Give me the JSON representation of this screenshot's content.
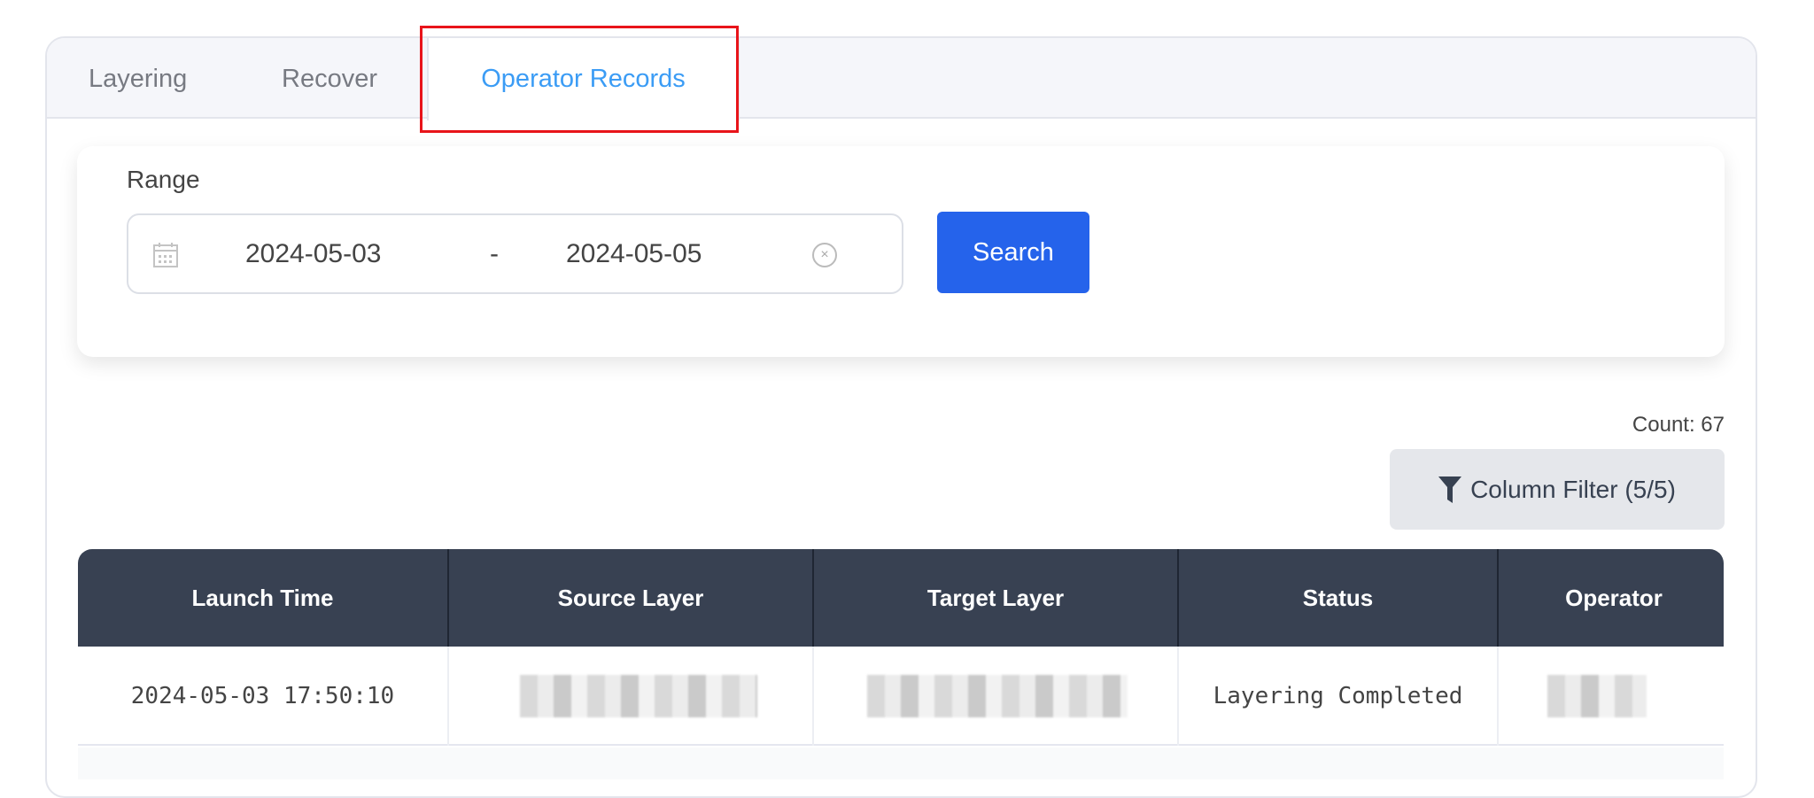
{
  "tabs": [
    {
      "label": "Layering"
    },
    {
      "label": "Recover"
    },
    {
      "label": "Operator Records",
      "active": true
    }
  ],
  "filter": {
    "range_label": "Range",
    "start_date": "2024-05-03",
    "separator": "-",
    "end_date": "2024-05-05",
    "search_label": "Search"
  },
  "toolbar": {
    "count": "Count: 67",
    "column_filter_label": "Column Filter (5/5)"
  },
  "table": {
    "columns": [
      "Launch Time",
      "Source Layer",
      "Target Layer",
      "Status",
      "Operator"
    ],
    "rows": [
      {
        "launch_time": "2024-05-03 17:50:10",
        "status": "Layering Completed"
      }
    ]
  },
  "colors": {
    "accent": "#2563eb",
    "active_tab": "#3b9cf5",
    "header": "#384152"
  }
}
